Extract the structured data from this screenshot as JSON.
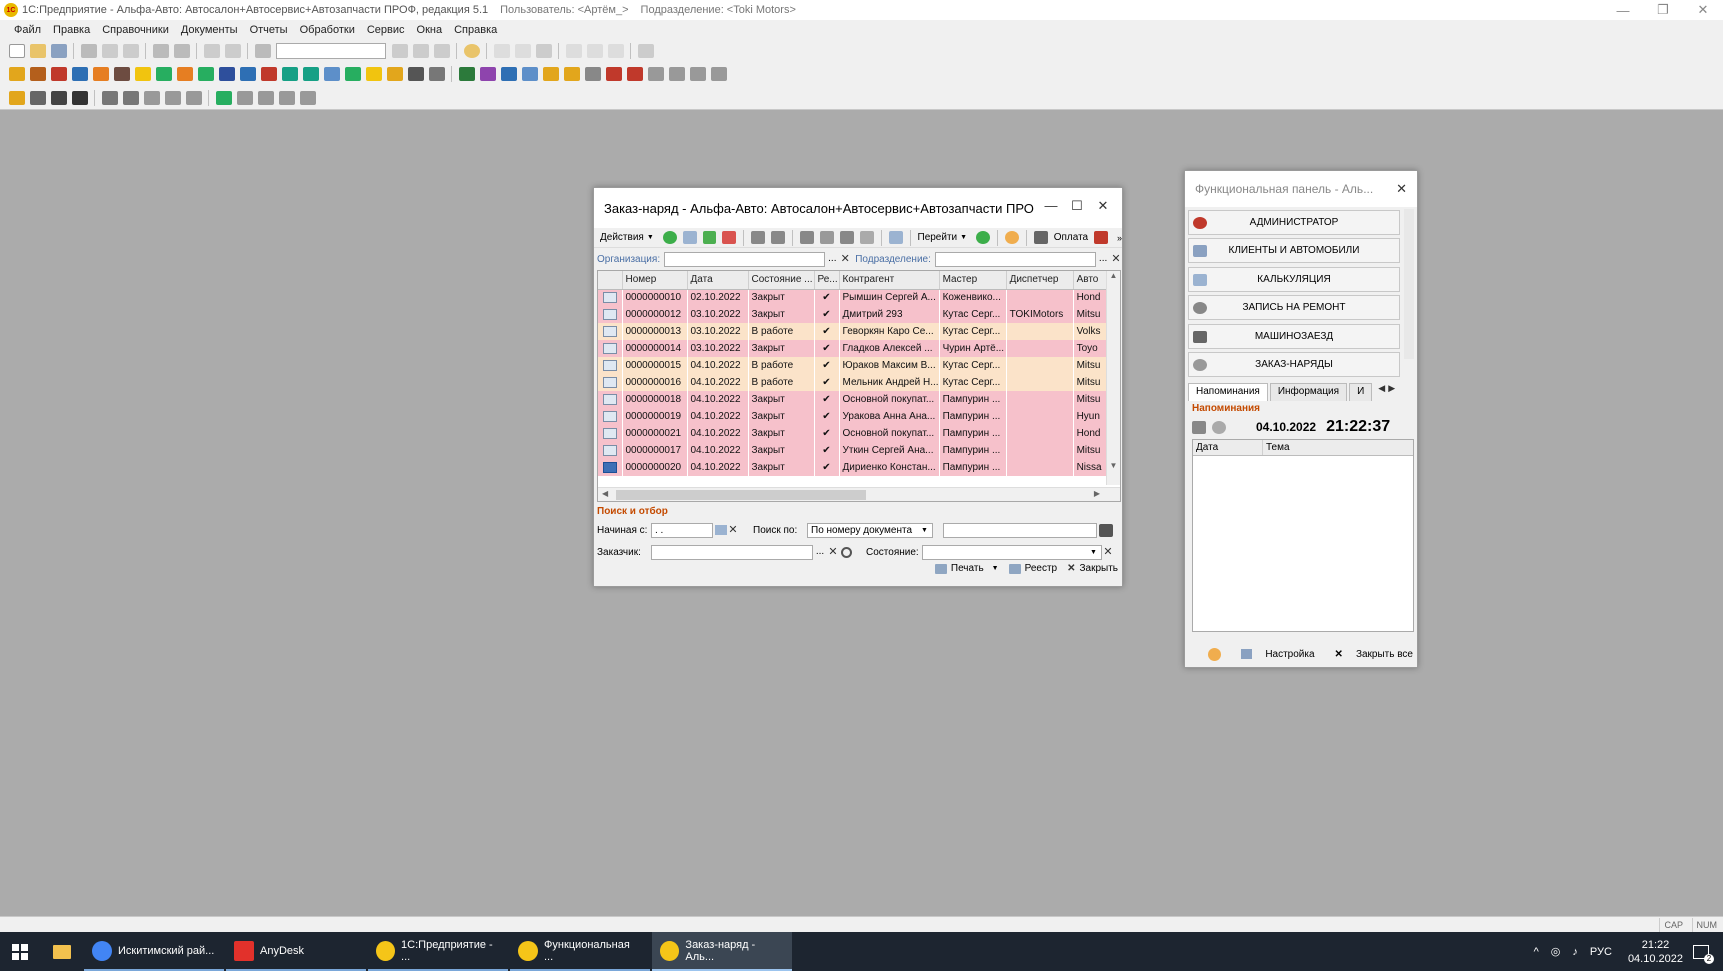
{
  "app": {
    "title": "1С:Предприятие - Альфа-Авто: Автосалон+Автосервис+Автозапчасти ПРОФ, редакция 5.1",
    "user": "Пользователь: <Артём_>",
    "department": "Подразделение: <Toki Motors>",
    "logo_text": "1С"
  },
  "menu": [
    "Файл",
    "Правка",
    "Справочники",
    "Документы",
    "Отчеты",
    "Обработки",
    "Сервис",
    "Окна",
    "Справка"
  ],
  "form": {
    "title": "Заказ-наряд - Альфа-Авто: Автосалон+Автосервис+Автозапчасти ПРО...",
    "toolbar": {
      "actions": "Действия",
      "goto": "Перейти",
      "payment": "Оплата"
    },
    "org_label": "Организация:",
    "dept_label": "Подразделение:",
    "columns": [
      "Номер",
      "Дата",
      "Состояние ...",
      "Ре...",
      "Контрагент",
      "Мастер",
      "Диспетчер",
      "Авто"
    ],
    "rows": [
      {
        "num": "0000000010",
        "date": "02.10.2022",
        "state": "Закрыт",
        "check": "✔",
        "client": "Рымшин Сергей А...",
        "master": "Коженвико...",
        "dispatcher": "",
        "car": "Hond",
        "status": "closed"
      },
      {
        "num": "0000000012",
        "date": "03.10.2022",
        "state": "Закрыт",
        "check": "✔",
        "client": "Дмитрий 293",
        "master": "Кутас Серг...",
        "dispatcher": "TOKIMotors",
        "car": "Mitsu",
        "status": "closed"
      },
      {
        "num": "0000000013",
        "date": "03.10.2022",
        "state": "В работе",
        "check": "✔",
        "client": "Геворкян Каро Се...",
        "master": "Кутас Серг...",
        "dispatcher": "",
        "car": "Volks",
        "status": "working"
      },
      {
        "num": "0000000014",
        "date": "03.10.2022",
        "state": "Закрыт",
        "check": "✔",
        "client": "Гладков Алексей ...",
        "master": "Чурин Артё...",
        "dispatcher": "",
        "car": "Toyo",
        "status": "closed"
      },
      {
        "num": "0000000015",
        "date": "04.10.2022",
        "state": "В работе",
        "check": "✔",
        "client": "Юраков Максим В...",
        "master": "Кутас Серг...",
        "dispatcher": "",
        "car": "Mitsu",
        "status": "working"
      },
      {
        "num": "0000000016",
        "date": "04.10.2022",
        "state": "В работе",
        "check": "✔",
        "client": "Мельник Андрей Н...",
        "master": "Кутас Серг...",
        "dispatcher": "",
        "car": "Mitsu",
        "status": "working"
      },
      {
        "num": "0000000018",
        "date": "04.10.2022",
        "state": "Закрыт",
        "check": "✔",
        "client": "Основной покупат...",
        "master": "Пампурин ...",
        "dispatcher": "",
        "car": "Mitsu",
        "status": "closed"
      },
      {
        "num": "0000000019",
        "date": "04.10.2022",
        "state": "Закрыт",
        "check": "✔",
        "client": "Уракова Анна Ана...",
        "master": "Пампурин ...",
        "dispatcher": "",
        "car": "Hyun",
        "status": "closed"
      },
      {
        "num": "0000000021",
        "date": "04.10.2022",
        "state": "Закрыт",
        "check": "✔",
        "client": "Основной покупат...",
        "master": "Пампурин ...",
        "dispatcher": "",
        "car": "Hond",
        "status": "closed"
      },
      {
        "num": "0000000017",
        "date": "04.10.2022",
        "state": "Закрыт",
        "check": "✔",
        "client": "Уткин Сергей Ана...",
        "master": "Пампурин ...",
        "dispatcher": "",
        "car": "Mitsu",
        "status": "closed"
      },
      {
        "num": "0000000020",
        "date": "04.10.2022",
        "state": "Закрыт",
        "check": "✔",
        "client": "Дириенко Констан...",
        "master": "Пампурин ...",
        "dispatcher": "",
        "car": "Nissa",
        "status": "selected"
      }
    ],
    "search": {
      "title": "Поиск и отбор",
      "start_label": "Начиная с:",
      "start_value": ". .",
      "search_by_label": "Поиск по:",
      "search_by_value": "По номеру документа",
      "customer_label": "Заказчик:",
      "state_label": "Состояние:"
    },
    "bottom": {
      "print": "Печать",
      "registry": "Реестр",
      "close": "Закрыть"
    }
  },
  "panel": {
    "title": "Функциональная панель - Аль...",
    "buttons": [
      "АДМИНИСТРАТОР",
      "КЛИЕНТЫ И АВТОМОБИЛИ",
      "КАЛЬКУЛЯЦИЯ",
      "ЗАПИСЬ НА РЕМОНТ",
      "МАШИНОЗАЕЗД",
      "ЗАКАЗ-НАРЯДЫ"
    ],
    "tabs": [
      "Напоминания",
      "Информация",
      "И"
    ],
    "reminders_label": "Напоминания",
    "date": "04.10.2022",
    "time": "21:22:37",
    "col_date": "Дата",
    "col_topic": "Тема",
    "settings": "Настройка",
    "close_all": "Закрыть все"
  },
  "statusbar": {
    "cap": "CAP",
    "num": "NUM"
  },
  "taskbar": {
    "items": [
      {
        "label": "Искитимский рай...",
        "color": "#4285f4"
      },
      {
        "label": "AnyDesk",
        "color": "#e2312b"
      },
      {
        "label": "1С:Предприятие - ...",
        "color": "#f5c518"
      },
      {
        "label": "Функциональная ...",
        "color": "#f5c518"
      },
      {
        "label": "Заказ-наряд - Аль...",
        "color": "#f5c518"
      }
    ],
    "lang": "РУС",
    "time": "21:22",
    "date": "04.10.2022",
    "notifications": "2"
  }
}
